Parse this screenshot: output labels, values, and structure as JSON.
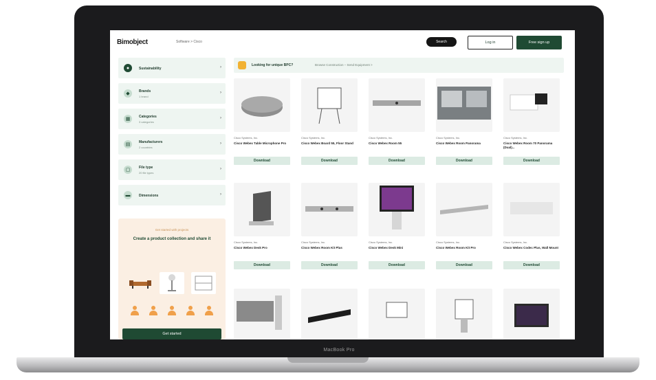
{
  "device": {
    "label": "MacBook Pro"
  },
  "header": {
    "logo": "Bimobject",
    "breadcrumb": "Software > Cisco",
    "search_label": "Search",
    "login_label": "Log in",
    "signup_label": "Free sign up"
  },
  "sidebar": {
    "items": [
      {
        "label": "Sustainability",
        "sub": ""
      },
      {
        "label": "Brands",
        "sub": "1 brand"
      },
      {
        "label": "Categories",
        "sub": "3 categories"
      },
      {
        "label": "Manufacturers",
        "sub": "2 countries"
      },
      {
        "label": "File type",
        "sub": "20 file types"
      },
      {
        "label": "Dimensions",
        "sub": ""
      }
    ]
  },
  "promo": {
    "eyebrow": "Get started with projects",
    "headline": "Create a product collection and share it",
    "cta": "Get started"
  },
  "banner": {
    "bold": "Looking for unique BPC?",
    "rest": "Browse Construction – Send Equipment >"
  },
  "products": [
    {
      "brand": "Cisco Systems, Inc.",
      "name": "Cisco Webex Table Microphone Pro",
      "action": "Download"
    },
    {
      "brand": "Cisco Systems, Inc.",
      "name": "Cisco Webex Board 55, Floor Stand",
      "action": "Download"
    },
    {
      "brand": "Cisco Systems, Inc.",
      "name": "Cisco Webex Room 55",
      "action": "Download"
    },
    {
      "brand": "Cisco Systems, Inc.",
      "name": "Cisco Webex Room Panorama",
      "action": "Download"
    },
    {
      "brand": "Cisco Systems, Inc.",
      "name": "Cisco Webex Room 70 Panorama (Dual)...",
      "action": "Download"
    },
    {
      "brand": "Cisco Systems, Inc.",
      "name": "Cisco Webex Desk Pro",
      "action": "Download"
    },
    {
      "brand": "Cisco Systems, Inc.",
      "name": "Cisco Webex Room Kit Plus",
      "action": "Download"
    },
    {
      "brand": "Cisco Systems, Inc.",
      "name": "Cisco Webex Desk Mini",
      "action": "Download"
    },
    {
      "brand": "Cisco Systems, Inc.",
      "name": "Cisco Webex Room Kit Pro",
      "action": "Download"
    },
    {
      "brand": "Cisco Systems, Inc.",
      "name": "Cisco Webex Codec Plus, Wall Mount",
      "action": "Download"
    },
    {
      "brand": "",
      "name": "",
      "action": ""
    },
    {
      "brand": "",
      "name": "",
      "action": ""
    },
    {
      "brand": "",
      "name": "",
      "action": ""
    },
    {
      "brand": "",
      "name": "",
      "action": ""
    },
    {
      "brand": "",
      "name": "",
      "action": ""
    }
  ],
  "colors": {
    "brand_green": "#1f4a33",
    "mint": "#eef5f1",
    "button_mint": "#dcebe3",
    "promo_peach": "#fbefe3",
    "accent_orange": "#f0a04a"
  }
}
